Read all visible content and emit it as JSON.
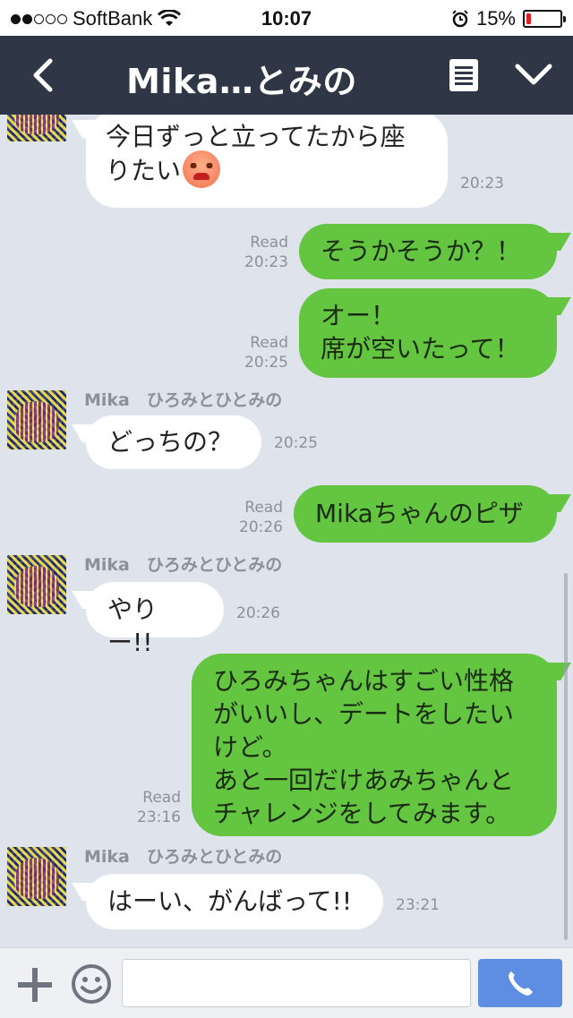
{
  "status": {
    "carrier": "SoftBank",
    "time": "10:07",
    "battery": "15%",
    "battery_level": 0.15,
    "signal_bars": 2
  },
  "header": {
    "title": "Mika…とみの"
  },
  "messages": [
    {
      "dir": "in",
      "text_line1": "今日ずっと立ってたから座",
      "text_line2": "りたい",
      "time": "20:23"
    },
    {
      "dir": "out",
      "text": "そうかそうか？！",
      "read": "Read",
      "time": "20:23"
    },
    {
      "dir": "out",
      "text_line1": "オー！",
      "text_line2": "席が空いたって！",
      "read": "Read",
      "time": "20:25"
    },
    {
      "dir": "in",
      "sender": "Mika　ひろみとひとみの",
      "text": "どっちの？",
      "time": "20:25"
    },
    {
      "dir": "out",
      "text": "Mikaちゃんのピザ",
      "read": "Read",
      "time": "20:26"
    },
    {
      "dir": "in",
      "sender": "Mika　ひろみとひとみの",
      "text": "やりー!!",
      "time": "20:26"
    },
    {
      "dir": "out",
      "text_line1": "ひろみちゃんはすごい性格",
      "text_line2": "がいいし、デートをしたい",
      "text_line3": "けど。",
      "text_line4": "あと一回だけあみちゃんと",
      "text_line5": "チャレンジをしてみます。",
      "read": "Read",
      "time": "23:16"
    },
    {
      "dir": "in",
      "sender": "Mika　ひろみとひとみの",
      "text": "はーい、がんばって!!",
      "time": "23:21"
    }
  ],
  "input": {
    "placeholder": ""
  },
  "icons": {
    "back": "chevron-left-icon",
    "menu": "note-list-icon",
    "expand": "chevron-down-icon",
    "add": "plus-icon",
    "emoji": "smiley-icon",
    "send": "phone-icon"
  },
  "colors": {
    "header_bg": "#2f3747",
    "chat_bg": "#dfe3ec",
    "outgoing_bubble": "#63c540",
    "incoming_bubble": "#ffffff",
    "send_button": "#5d8ee4"
  }
}
